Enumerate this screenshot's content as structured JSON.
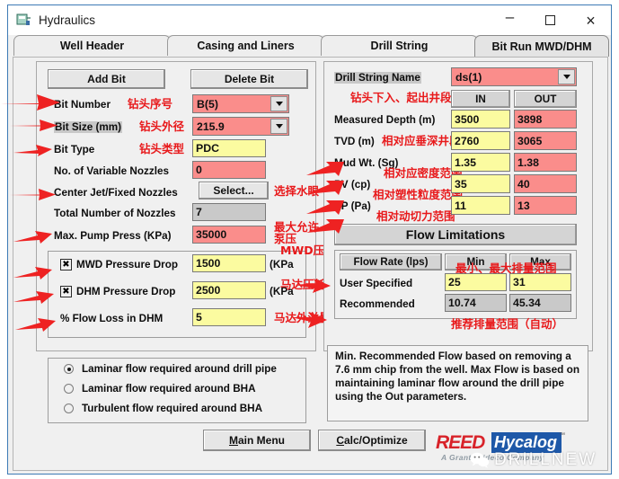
{
  "window": {
    "title": "Hydraulics",
    "icon": "app-icon",
    "minimize": "–",
    "maximize": "☐",
    "close": "×"
  },
  "tabs": [
    {
      "label": "Well Header",
      "selected": false
    },
    {
      "label": "Casing and Liners",
      "selected": false
    },
    {
      "label": "Drill String",
      "selected": false
    },
    {
      "label": "Bit Run MWD/DHM",
      "selected": true
    }
  ],
  "left_panel": {
    "add_bit": "Add Bit",
    "delete_bit": "Delete Bit",
    "rows": [
      {
        "label": "Bit Number",
        "value": "B(5)",
        "type": "combo",
        "style": "pink",
        "annotation": "钻头序号"
      },
      {
        "label": "Bit Size (mm)",
        "value": "215.9",
        "type": "combo",
        "style": "pink",
        "annotation": "钻头外径",
        "label_highlight": true
      },
      {
        "label": "Bit Type",
        "value": "PDC",
        "type": "field",
        "style": "yellow",
        "annotation": "钻头类型"
      },
      {
        "label": "No. of Variable Nozzles",
        "value": "0",
        "type": "field",
        "style": "pink",
        "annotation": ""
      },
      {
        "label": "Center Jet/Fixed Nozzles",
        "value": "Select...",
        "type": "button",
        "style": "button",
        "annotation": "选择水眼"
      },
      {
        "label": "Total Number of Nozzles",
        "value": "7",
        "type": "field",
        "style": "grey",
        "annotation": ""
      },
      {
        "label": "Max. Pump Press (KPa)",
        "value": "35000",
        "type": "field",
        "style": "pink",
        "annotation": "最大允许\n泵压"
      }
    ],
    "checkbox_group": [
      {
        "checked": true,
        "label": "MWD Pressure Drop",
        "value": "1500",
        "unit": "(KPa",
        "annotation": "MWD压耗"
      },
      {
        "checked": true,
        "label": "DHM Pressure Drop",
        "value": "2500",
        "unit": "(KPa",
        "annotation": "马达压耗"
      },
      {
        "checked": null,
        "label": "% Flow Loss in DHM",
        "value": "5",
        "unit": "",
        "annotation": "马达外溢量"
      }
    ],
    "radios": [
      {
        "label": "Laminar flow required around drill pipe",
        "selected": true
      },
      {
        "label": "Laminar flow required around BHA",
        "selected": false
      },
      {
        "label": "Turbulent flow required around BHA",
        "selected": false
      }
    ]
  },
  "right_panel": {
    "drill_string_label": "Drill String Name",
    "drill_string_value": "ds(1)",
    "io_header": {
      "in": "IN",
      "out": "OUT"
    },
    "io_annotation": "钻头下入、起出井段",
    "params": [
      {
        "label": "Measured Depth (m)",
        "in": "3500",
        "out": "3898",
        "annotation": ""
      },
      {
        "label": "TVD (m)",
        "in": "2760",
        "out": "3065",
        "annotation": "相对应垂深井段"
      },
      {
        "label": "Mud Wt. (Sg)",
        "in": "1.35",
        "out": "1.38",
        "annotation": "相对应密度范围"
      },
      {
        "label": "PV (cp)",
        "in": "35",
        "out": "40",
        "annotation": "相对塑性粒度范围"
      },
      {
        "label": "YP (Pa)",
        "in": "11",
        "out": "13",
        "annotation": "相对动切力范围"
      }
    ],
    "flow_limitations_title": "Flow Limitations",
    "flow_table": {
      "header": [
        "Flow Rate (lps)",
        "Min",
        "Max"
      ],
      "header_annotation": "最小、最大排量范围",
      "rows": [
        {
          "label": "User Specified",
          "min": "25",
          "max": "31",
          "style": "yellow"
        },
        {
          "label": "Recommended",
          "min": "10.74",
          "max": "45.34",
          "style": "grey"
        }
      ],
      "footer_annotation": "推荐排量范围（自动）"
    },
    "note": "Min. Recommended Flow based on removing a 7.6 mm chip from the well.  Max Flow is based on maintaining laminar flow around the drill pipe using the Out parameters."
  },
  "footer": {
    "main_menu": "Main Menu",
    "main_menu_mnemonic": "M",
    "calc_optimize": "Calc/Optimize",
    "calc_mnemonic": "C",
    "logo": {
      "brand": "REED",
      "product": "Hycalog",
      "tm": "™",
      "tagline": "A Grant Prideco Company"
    },
    "watermark": "DRILLNEW"
  },
  "colors": {
    "pink_field": "#fa8d8b",
    "yellow_field": "#fbfba0",
    "grey_field": "#c9c9c9",
    "annotation_red": "#e8191b",
    "window_border": "#3d7ab5",
    "brand_red": "#d8232a",
    "brand_blue": "#1e58a8"
  }
}
